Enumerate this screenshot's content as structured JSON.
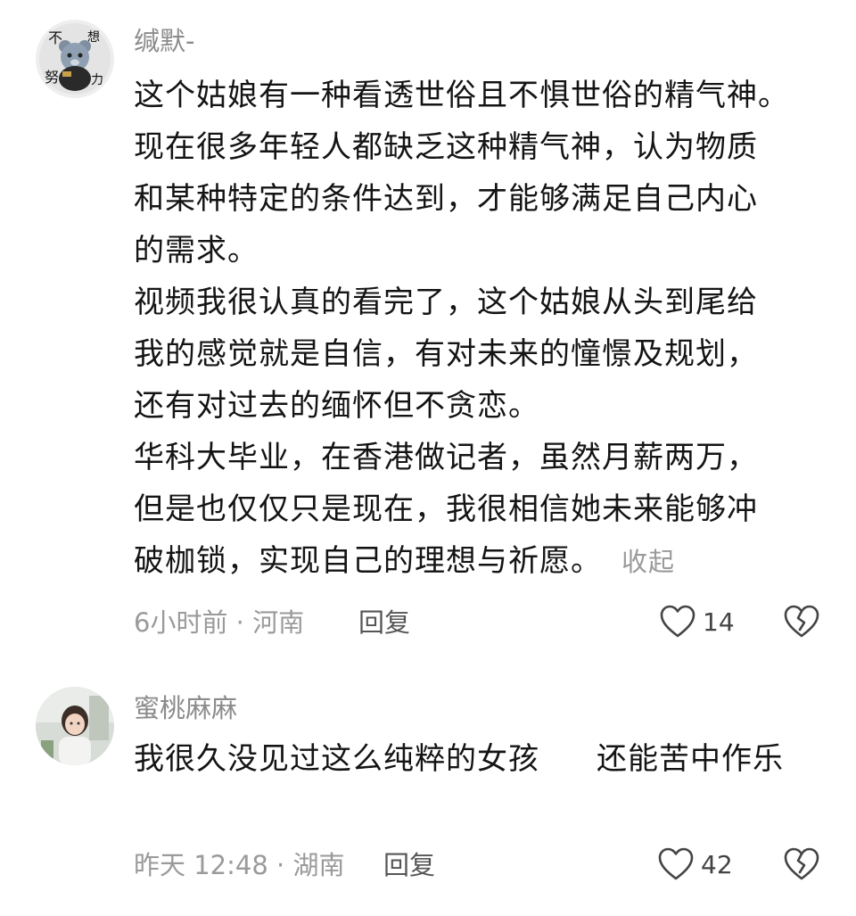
{
  "comments": [
    {
      "username": "缄默-",
      "avatar_icon": "cartoon-bear-avatar-icon",
      "lines": [
        "这个姑娘有一种看透世俗且不惧世俗的精气神。",
        "现在很多年轻人都缺乏这种精气神，认为物质",
        "和某种特定的条件达到，才能够满足自己内心",
        "的需求。",
        "视频我很认真的看完了，这个姑娘从头到尾给",
        "我的感觉就是自信，有对未来的憧憬及规划，",
        "还有对过去的缅怀但不贪恋。",
        "华科大毕业，在香港做记者，虽然月薪两万，",
        "但是也仅仅只是现在，我很相信她未来能够冲",
        "破枷锁，实现自己的理想与祈愿。"
      ],
      "collapse_label": "收起",
      "time_location": "6小时前 · 河南",
      "reply_label": "回复",
      "like_count": "14",
      "like_icon": "heart-outline-icon",
      "dislike_icon": "broken-heart-icon"
    },
    {
      "username": "蜜桃麻麻",
      "avatar_icon": "child-photo-avatar-icon",
      "text_part1": "我很久没见过这么纯粹的女孩",
      "text_part2": "还能苦中作乐",
      "time_location": "昨天 12:48 · 湖南",
      "reply_label": "回复",
      "like_count": "42",
      "like_icon": "heart-outline-icon",
      "dislike_icon": "broken-heart-icon"
    }
  ],
  "colors": {
    "background": "#ffffff",
    "text": "#141414",
    "muted": "#9a9a9a",
    "username": "#8b8b8b"
  }
}
